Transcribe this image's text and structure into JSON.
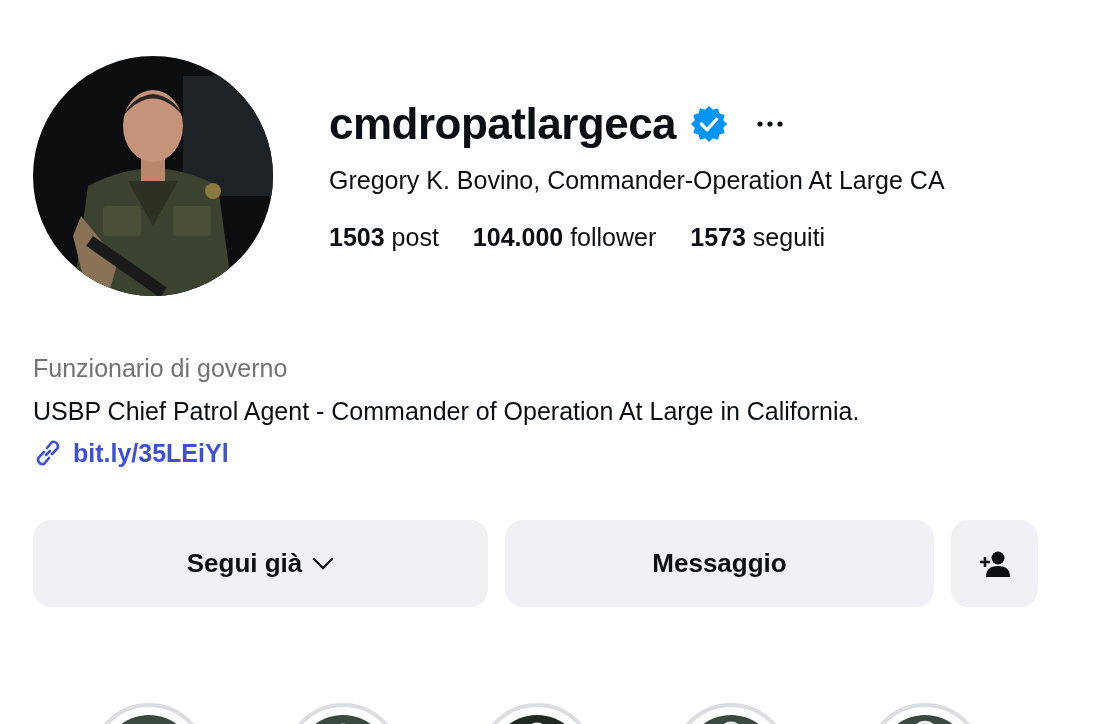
{
  "profile": {
    "username": "cmdropatlargeca",
    "verified": true,
    "full_name": "Gregory K. Bovino, Commander-Operation At Large CA",
    "stats": [
      "**1503** post",
      "**104.000** follower",
      "**1573** seguiti"
    ],
    "category": "Funzionario di governo",
    "bio": "USBP Chief Patrol Agent - Commander of Operation At Large in California.",
    "link": "bit.ly/35LEiYl"
  },
  "buttons": [
    {
      "kind": "follow",
      "label": "Segui già"
    },
    {
      "kind": "message",
      "label": "Messaggio"
    },
    {
      "kind": "suggest"
    }
  ]
}
